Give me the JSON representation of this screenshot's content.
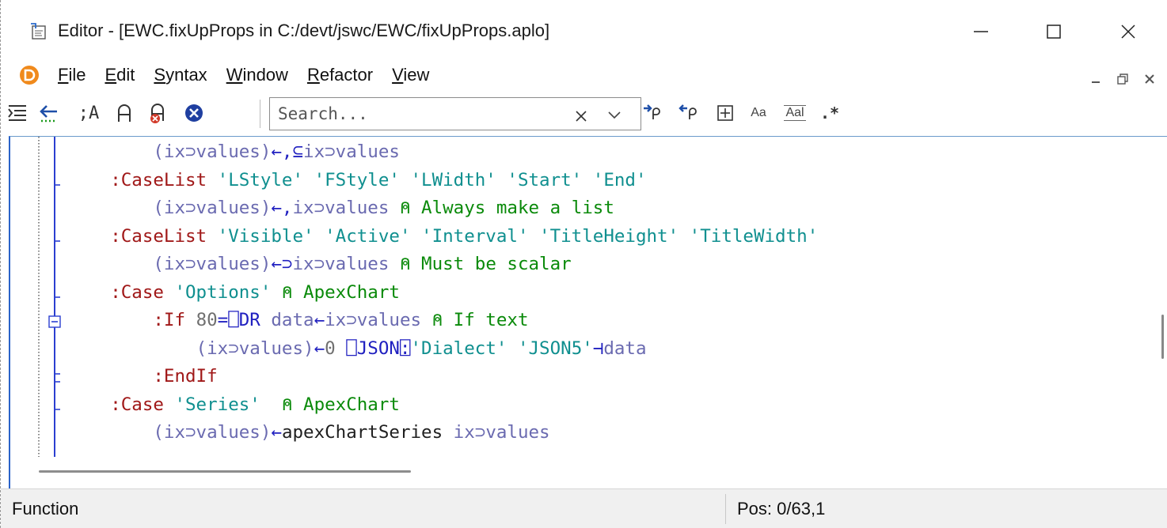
{
  "window": {
    "title": "Editor - [EWC.fixUpProps in C:/devt/jswc/EWC/fixUpProps.aplo]",
    "controls": {
      "minimize": "—",
      "maximize": "☐",
      "close": "✕"
    }
  },
  "menu": {
    "items": [
      {
        "accel": "F",
        "rest": "ile"
      },
      {
        "accel": "E",
        "rest": "dit"
      },
      {
        "accel": "S",
        "rest": "yntax"
      },
      {
        "accel": "W",
        "rest": "indow"
      },
      {
        "accel": "R",
        "rest": "efactor"
      },
      {
        "accel": "V",
        "rest": "iew"
      }
    ],
    "mdi": {
      "minimize": "–",
      "restore": "🗗",
      "close": "×"
    }
  },
  "toolbar": {
    "icons": {
      "format": "☰",
      "back": "←",
      "comment": ";A",
      "toggle_comment": "⍝",
      "uncomment": "⍝",
      "close": "✕",
      "search_next": "⍴",
      "search_prev": "⍴",
      "expand": "⊞",
      "match_case": "Aa",
      "whole_word": "Aal",
      "regex": ".*"
    },
    "search": {
      "placeholder": "Search...",
      "value": "",
      "clear": "×"
    }
  },
  "editor": {
    "lines": [
      [
        {
          "t": "        ",
          "c": ""
        },
        {
          "t": "(ix⊃values)",
          "c": "var"
        },
        {
          "t": "←,⊆",
          "c": "op"
        },
        {
          "t": "ix⊃values",
          "c": "var"
        }
      ],
      [
        {
          "t": "    ",
          "c": ""
        },
        {
          "t": ":CaseList",
          "c": "kw"
        },
        {
          "t": " ",
          "c": ""
        },
        {
          "t": "'LStyle' 'FStyle' 'LWidth' 'Start' 'End'",
          "c": "str"
        }
      ],
      [
        {
          "t": "        ",
          "c": ""
        },
        {
          "t": "(ix⊃values)",
          "c": "var"
        },
        {
          "t": "←,",
          "c": "op"
        },
        {
          "t": "ix⊃values",
          "c": "var"
        },
        {
          "t": " ⍝ Always make a list",
          "c": "cmt"
        }
      ],
      [
        {
          "t": "    ",
          "c": ""
        },
        {
          "t": ":CaseList",
          "c": "kw"
        },
        {
          "t": " ",
          "c": ""
        },
        {
          "t": "'Visible' 'Active' 'Interval' 'TitleHeight' 'TitleWidth'",
          "c": "str"
        }
      ],
      [
        {
          "t": "        ",
          "c": ""
        },
        {
          "t": "(ix⊃values)",
          "c": "var"
        },
        {
          "t": "←⊃",
          "c": "op"
        },
        {
          "t": "ix⊃values",
          "c": "var"
        },
        {
          "t": " ⍝ Must be scalar",
          "c": "cmt"
        }
      ],
      [
        {
          "t": "    ",
          "c": ""
        },
        {
          "t": ":Case",
          "c": "kw"
        },
        {
          "t": " ",
          "c": ""
        },
        {
          "t": "'Options'",
          "c": "str"
        },
        {
          "t": " ⍝ ApexChart",
          "c": "cmt"
        }
      ],
      [
        {
          "t": "        ",
          "c": ""
        },
        {
          "t": ":If",
          "c": "kw"
        },
        {
          "t": " ",
          "c": ""
        },
        {
          "t": "80",
          "c": "num"
        },
        {
          "t": "=⎕DR",
          "c": "sysfn"
        },
        {
          "t": " data",
          "c": "var"
        },
        {
          "t": "←",
          "c": "op"
        },
        {
          "t": "ix⊃values",
          "c": "var"
        },
        {
          "t": " ⍝ If text",
          "c": "cmt"
        }
      ],
      [
        {
          "t": "            ",
          "c": ""
        },
        {
          "t": "(ix⊃values)",
          "c": "var"
        },
        {
          "t": "←",
          "c": "op"
        },
        {
          "t": "0 ",
          "c": "num"
        },
        {
          "t": "⎕JSON⍠",
          "c": "sysfn"
        },
        {
          "t": "'Dialect' 'JSON5'",
          "c": "str"
        },
        {
          "t": "⊣",
          "c": "op"
        },
        {
          "t": "data",
          "c": "var"
        }
      ],
      [
        {
          "t": "        ",
          "c": ""
        },
        {
          "t": ":EndIf",
          "c": "kw"
        }
      ],
      [
        {
          "t": "    ",
          "c": ""
        },
        {
          "t": ":Case",
          "c": "kw"
        },
        {
          "t": " ",
          "c": ""
        },
        {
          "t": "'Series'",
          "c": "str"
        },
        {
          "t": "  ⍝ ApexChart",
          "c": "cmt"
        }
      ],
      [
        {
          "t": "        ",
          "c": ""
        },
        {
          "t": "(ix⊃values)",
          "c": "var"
        },
        {
          "t": "←",
          "c": "op"
        },
        {
          "t": "apexChartSeries",
          "c": "fn"
        },
        {
          "t": " ix⊃values",
          "c": "var"
        }
      ]
    ]
  },
  "status": {
    "left": "Function",
    "right": "Pos: 0/63,1"
  }
}
